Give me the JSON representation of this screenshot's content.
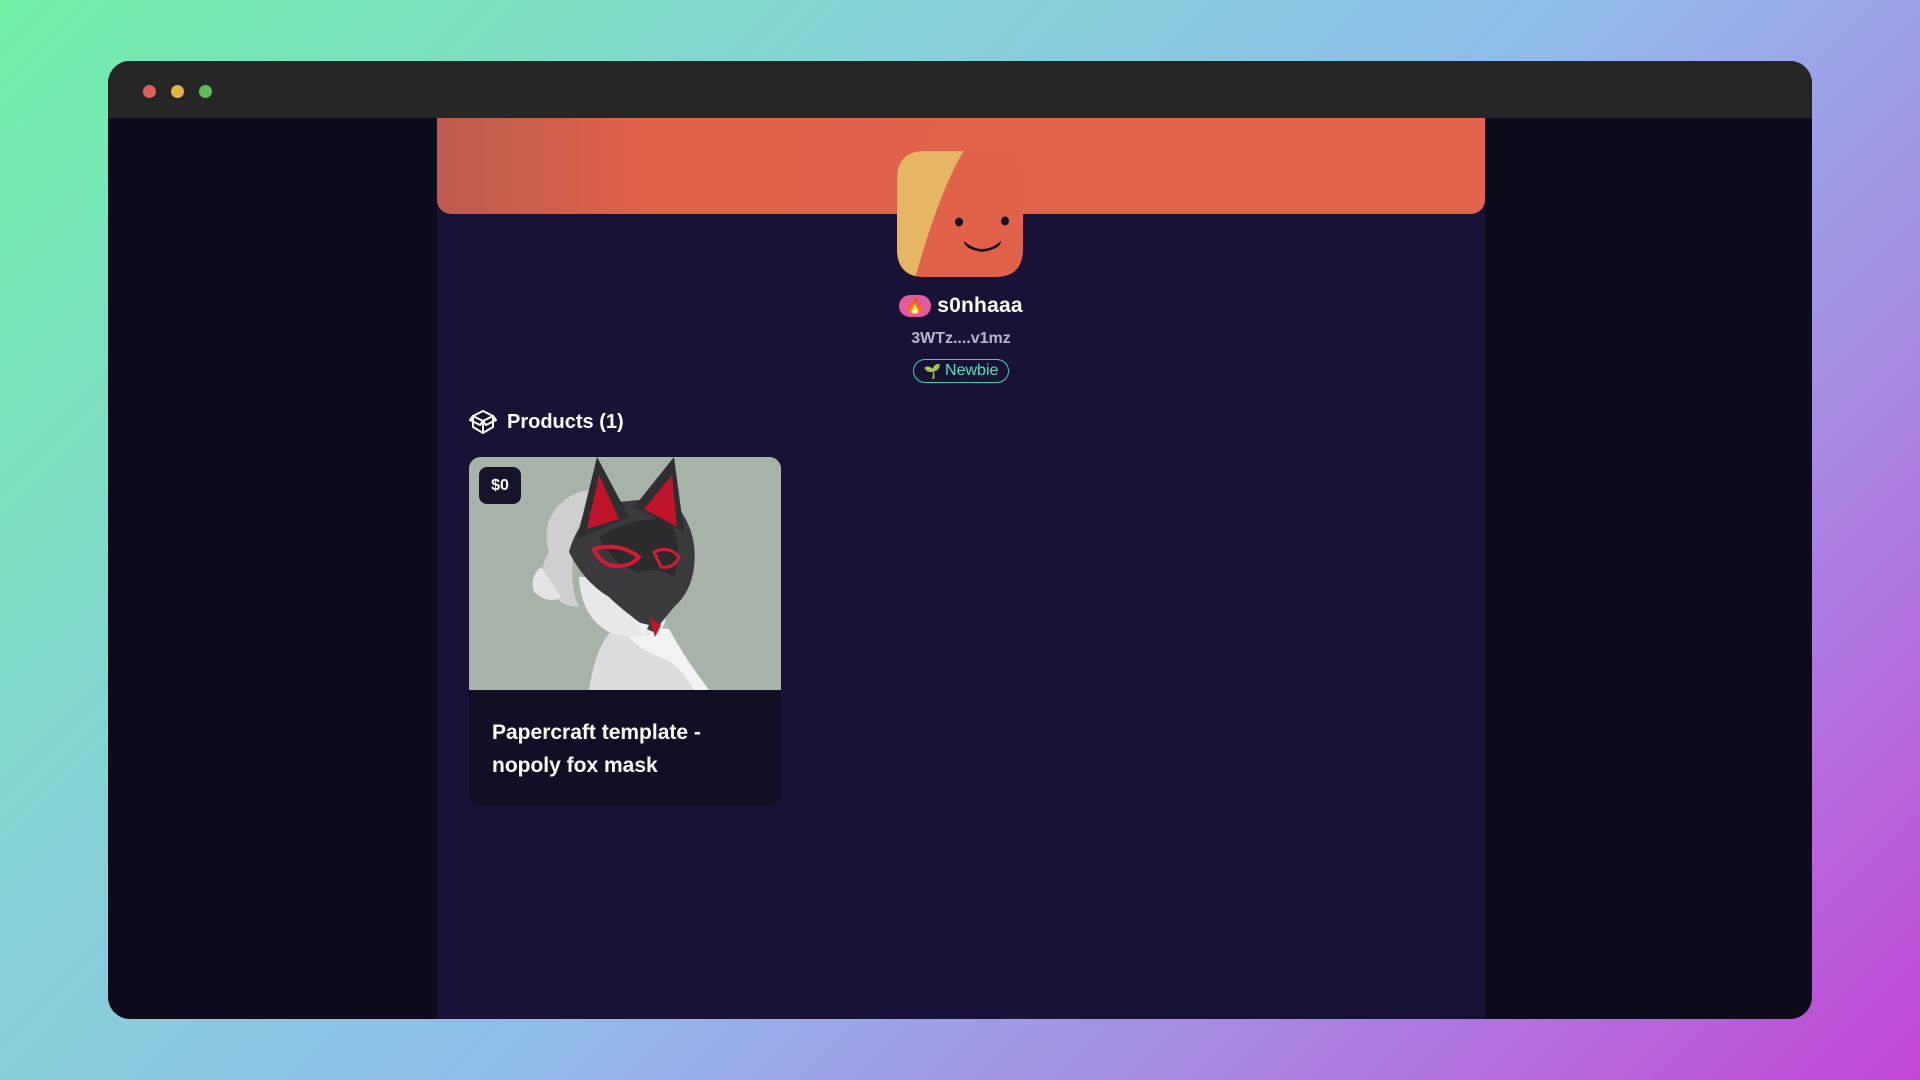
{
  "window": {
    "controls": [
      "close",
      "minimize",
      "maximize"
    ]
  },
  "profile": {
    "username": "s0nhaaa",
    "wallet": "3WTz....v1mz",
    "fire_badge": "🔥",
    "tier": {
      "icon": "🌱",
      "label": "Newbie"
    },
    "avatar_icon": "smiley-blob-avatar"
  },
  "products": {
    "icon": "box-icon",
    "title": "Products (1)",
    "items": [
      {
        "price": "$0",
        "title": "Papercraft template - nopoly fox mask",
        "image": "fox-mask-image"
      }
    ]
  },
  "colors": {
    "banner": "#e3644d",
    "page_bg": "#171236",
    "outer_bg": "#0e0c1c",
    "tier_accent": "#3dd2b2",
    "fire_badge": "#e35b9f"
  }
}
